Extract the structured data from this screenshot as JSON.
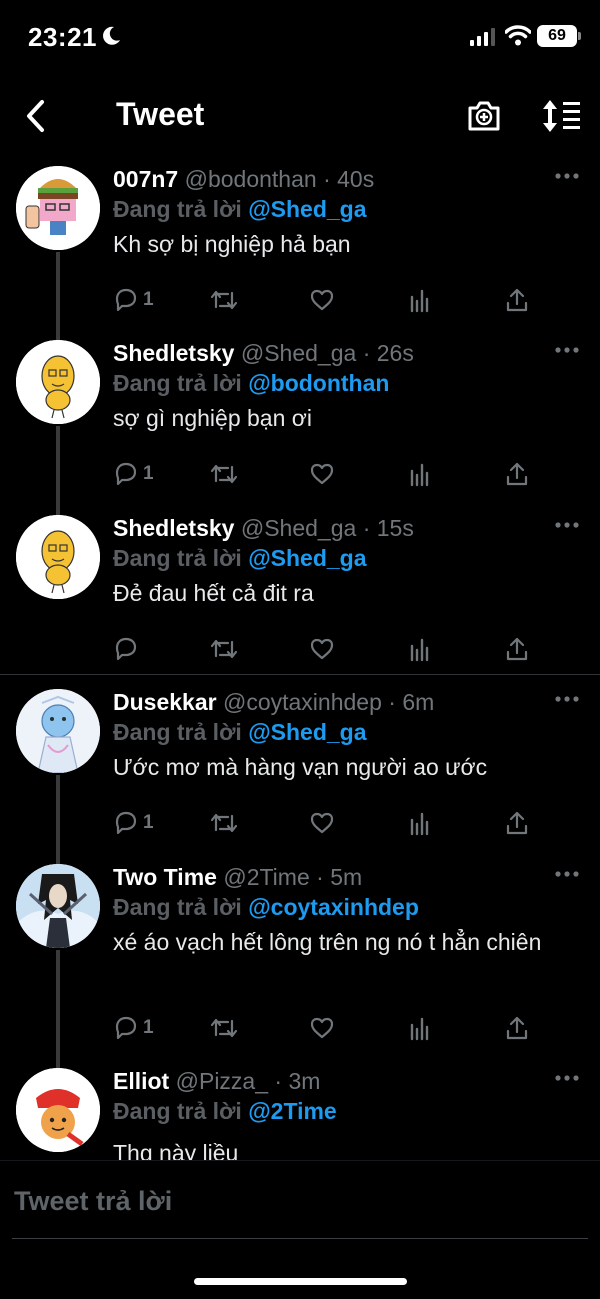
{
  "status_bar": {
    "time": "23:21",
    "battery": "69"
  },
  "header": {
    "title": "Tweet"
  },
  "replying_prefix": "Đang trả lời",
  "tweets": [
    {
      "name": "007n7",
      "handle": "@bodonthan",
      "time": "40s",
      "replying_to": "@Shed_ga",
      "text": "Kh sợ bị nghiệp hả bạn",
      "reply_count": "1"
    },
    {
      "name": "Shedletsky",
      "handle": "@Shed_ga",
      "time": "26s",
      "replying_to": "@bodonthan",
      "text": "sợ gì nghiệp bạn ơi",
      "reply_count": "1"
    },
    {
      "name": "Shedletsky",
      "handle": "@Shed_ga",
      "time": "15s",
      "replying_to": "@Shed_ga",
      "text": "Đẻ đau hết cả đit ra",
      "reply_count": ""
    },
    {
      "name": "Dusekkar",
      "handle": "@coytaxinhdep",
      "time": "6m",
      "replying_to": "@Shed_ga",
      "text": "Ước mơ mà hàng vạn người ao ước",
      "reply_count": "1"
    },
    {
      "name": "Two Time",
      "handle": "@2Time",
      "time": "5m",
      "replying_to": "@coytaxinhdep",
      "text": "xé áo vạch hết lông trên ng nó t hẳn chiên",
      "reply_count": "1"
    },
    {
      "name": "Elliot",
      "handle": "@Pizza_",
      "time": "3m",
      "replying_to": "@2Time",
      "text": "Thg này liều",
      "reply_count": ""
    }
  ],
  "reply_bar": {
    "placeholder": "Tweet trả lời"
  }
}
